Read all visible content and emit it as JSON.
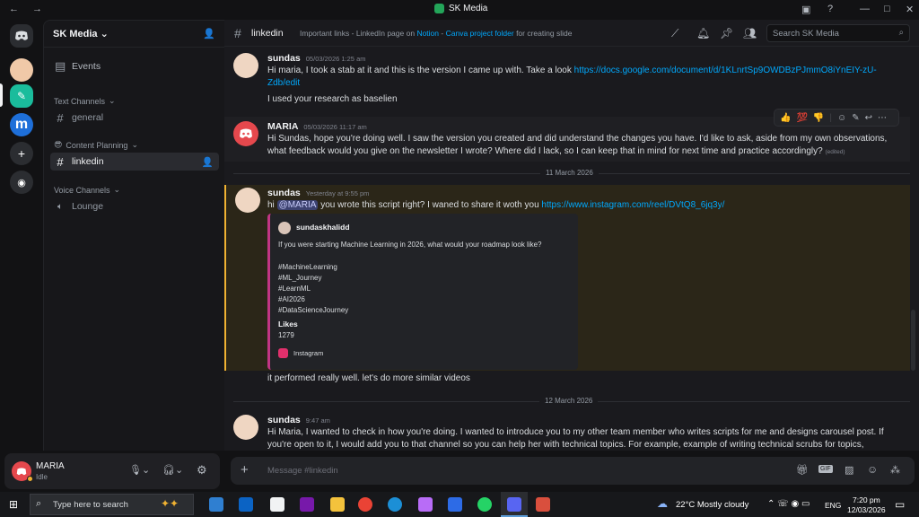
{
  "window": {
    "title": "SK Media",
    "nav_arrows": "← →"
  },
  "server_name": "SK Media",
  "sidebar": {
    "events_label": "Events",
    "text_channels_label": "Text Channels",
    "general": "general",
    "content_planning_label": "Content Planning",
    "content_planning_emoji": "😎",
    "linkedin": "linkedin",
    "voice_channels_label": "Voice Channels",
    "lounge": "Lounge"
  },
  "header": {
    "channel": "linkedin",
    "topic_pre": "Important links - LinkedIn page on",
    "topic_notion": "Notion",
    "topic_sep": "-",
    "topic_canva": "Canva project folder",
    "topic_post": "for creating slide",
    "search_placeholder": "Search SK Media"
  },
  "messages": {
    "m1_user": "sundas",
    "m1_time": "05/03/2026 1:25 am",
    "m1_text": "Hi maria, I took a stab at it and this is the version I came up with. Take a look",
    "m1_link": "https://docs.google.com/document/d/1KLnrtSp9OWDBzPJmmO8iYnEIY-zU-Zdb/edit",
    "m1_text2": "I used your research as baselien",
    "m2_user": "MARIA",
    "m2_time": "05/03/2026 11:17 am",
    "m2_text": "Hi Sundas, hope you're doing well. I saw the version you created and did understand the changes you have. I'd like to ask, aside from my own observations, what feedback would you give on the newsletter I wrote? Where did I lack, so I can keep that in mind for next time and practice accordingly?",
    "m2_edited": "(edited)",
    "date1": "11 March 2026",
    "m3_user": "sundas",
    "m3_time": "Yesterday at 9:55 pm",
    "m3_hi": "hi",
    "m3_mention": "@MARIA",
    "m3_text": "you wrote this script right? I waned to share it woth you",
    "m3_link": "https://www.instagram.com/reel/DVtQ8_6jq3y/",
    "embed_author": "sundaskhalidd",
    "embed_q": "If you were starting Machine Learning in 2026, what would your roadmap look like?",
    "embed_tags": [
      "#MachineLearning",
      "#ML_Journey",
      "#LearnML",
      "#AI2026",
      "#DataScienceJourney"
    ],
    "embed_likes_label": "Likes",
    "embed_likes": "1279",
    "embed_footer": "Instagram",
    "m3_text2": "it performed really well. let's do more similar videos",
    "date2": "12 March 2026",
    "m4_user": "sundas",
    "m4_time": "9:47 am",
    "m4_text": "Hi Maria, I wanted to check in how you're doing. I wanted to introduce you to my other team member who writes scripts for me and designs carousel post. If you're open to it, I would add you to that channel so you can help her with technical topics.  For example, example of writing technical scrubs for topics,"
  },
  "reactions": [
    "👍",
    "💯",
    "👎"
  ],
  "composer": {
    "placeholder": "Message #linkedin"
  },
  "user": {
    "name": "MARIA",
    "status": "Idle"
  },
  "taskbar": {
    "search_placeholder": "Type here to search",
    "weather": "22°C  Mostly cloudy",
    "lang": "ENG",
    "time": "7:20 pm",
    "date": "12/03/2026"
  },
  "colors": {
    "accent": "#5865f2",
    "link": "#00a8fc",
    "online": "#23a559",
    "maria_avatar": "#e5484d"
  }
}
